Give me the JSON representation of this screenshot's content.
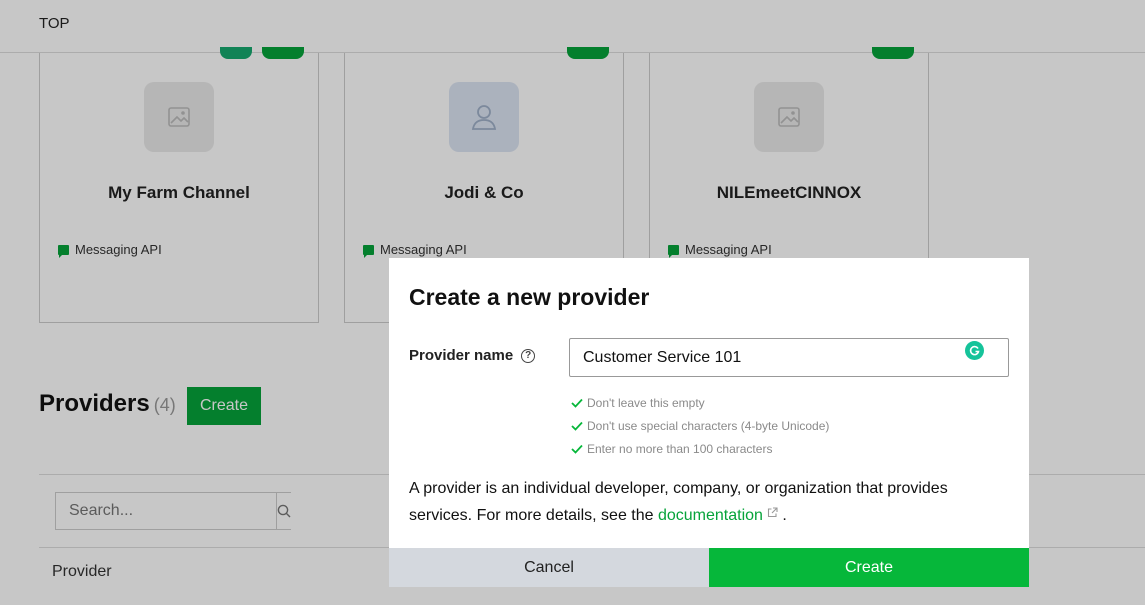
{
  "breadcrumb": "TOP",
  "channels": [
    {
      "name": "My Farm Channel",
      "type": "Messaging API",
      "thumb_icon": "image-placeholder-icon"
    },
    {
      "name": "Jodi & Co",
      "type": "Messaging API",
      "thumb_icon": "person-icon"
    },
    {
      "name": "NILEmeetCINNOX",
      "type": "Messaging API",
      "thumb_icon": "image-placeholder-icon"
    }
  ],
  "providers": {
    "title": "Providers",
    "count": "(4)",
    "create_label": "Create",
    "search_placeholder": "Search...",
    "column_provider": "Provider"
  },
  "modal": {
    "title": "Create a new provider",
    "field_label": "Provider name",
    "input_value": "Customer Service 101",
    "rules": [
      "Don't leave this empty",
      "Don't use special characters (4-byte Unicode)",
      "Enter no more than 100 characters"
    ],
    "description_before": "A provider is an individual developer, company, or organization that provides services. For more details, see the ",
    "link_text": "documentation",
    "description_after": " .",
    "cancel_label": "Cancel",
    "create_label": "Create"
  },
  "colors": {
    "brand_green": "#06b73a",
    "dark_green": "#06a33a",
    "cancel_gray": "#d4d8de"
  }
}
